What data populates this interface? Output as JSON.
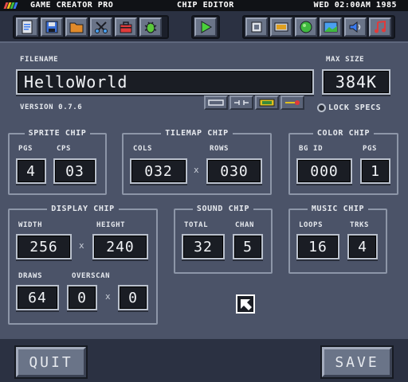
{
  "menubar": {
    "app_title": "GAME CREATOR PRO",
    "tool_title": "CHIP EDITOR",
    "clock": "WED 02:00AM 1985",
    "logo_colors": [
      "#e84a4a",
      "#f0c020",
      "#40c040",
      "#3a7af0"
    ]
  },
  "toolbar": {
    "left_icons": [
      "document-icon",
      "save-icon",
      "folder-icon",
      "cut-icon",
      "toolbox-icon",
      "bug-icon"
    ],
    "play_icon": "play-icon",
    "right_icons": [
      "settings-chip-icon",
      "display-icon",
      "color-ball-icon",
      "image-icon",
      "sound-icon",
      "music-icon"
    ]
  },
  "filename": {
    "label": "FILENAME",
    "value": "HelloWorld"
  },
  "max_size": {
    "label": "MAX SIZE",
    "value": "384K"
  },
  "version": {
    "label": "VERSION",
    "value": "0.7.6"
  },
  "lock_specs": {
    "label": "LOCK SPECS"
  },
  "sprite_chip": {
    "title": "SPRITE CHIP",
    "pgs_label": "PGS",
    "pgs_value": "4",
    "cps_label": "CPS",
    "cps_value": "03"
  },
  "tilemap_chip": {
    "title": "TILEMAP CHIP",
    "cols_label": "COLS",
    "cols_value": "032",
    "rows_label": "ROWS",
    "rows_value": "030",
    "times": "x"
  },
  "color_chip": {
    "title": "COLOR CHIP",
    "bg_label": "BG ID",
    "bg_value": "000",
    "pgs_label": "PGS",
    "pgs_value": "1"
  },
  "display_chip": {
    "title": "DISPLAY CHIP",
    "width_label": "WIDTH",
    "width_value": "256",
    "height_label": "HEIGHT",
    "height_value": "240",
    "times": "x",
    "draws_label": "DRAWS",
    "draws_value": "64",
    "overscan_label": "OVERSCAN",
    "overscan_x": "0",
    "overscan_y": "0",
    "times2": "x"
  },
  "sound_chip": {
    "title": "SOUND CHIP",
    "total_label": "TOTAL",
    "total_value": "32",
    "chan_label": "CHAN",
    "chan_value": "5"
  },
  "music_chip": {
    "title": "MUSIC CHIP",
    "loops_label": "LOOPS",
    "loops_value": "16",
    "trks_label": "TRKS",
    "trks_value": "4"
  },
  "bottom": {
    "quit_label": "QUIT",
    "save_label": "SAVE"
  },
  "colors": {
    "panel": "#4b5368",
    "background": "#2b3142",
    "field": "#1a1d24",
    "accent_green": "#3fb83f"
  }
}
